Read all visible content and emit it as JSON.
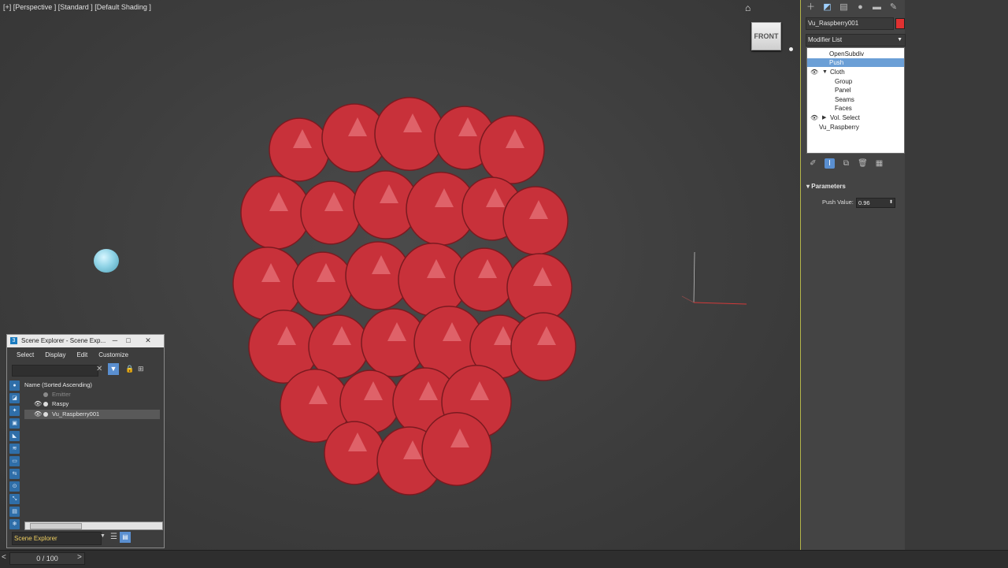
{
  "viewport": {
    "label": "[+] [Perspective ] [Standard ] [Default Shading ]",
    "viewcube_label": "FRONT",
    "object_color": "#c8313a"
  },
  "timeline": {
    "frame": "0 / 100",
    "prev": "<",
    "next": ">"
  },
  "command_panel": {
    "tab_icons": [
      "create-icon",
      "modify-icon",
      "hierarchy-icon",
      "motion-icon",
      "display-icon",
      "utilities-icon"
    ],
    "object_name": "Vu_Raspberry001",
    "object_color": "#e03131",
    "modifier_list_label": "Modifier List",
    "stack": {
      "opensubdiv": "OpenSubdiv",
      "push": "Push",
      "cloth": "Cloth",
      "group": "Group",
      "panel": "Panel",
      "seams": "Seams",
      "faces": "Faces",
      "vol_select": "Vol. Select",
      "base": "Vu_Raspberry"
    },
    "parameters_title": "Parameters",
    "push_value_label": "Push Value:",
    "push_value": "0.96"
  },
  "scene_explorer": {
    "title": "Scene Explorer - Scene Exp...",
    "app_icon": "3",
    "menu": {
      "select": "Select",
      "display": "Display",
      "edit": "Edit",
      "customize": "Customize"
    },
    "column_header": "Name (Sorted Ascending)",
    "rows": {
      "emitter": "Emitter",
      "raspy": "Raspy",
      "vu_raspberry001": "Vu_Raspberry001"
    },
    "footer_label": "Scene Explorer"
  }
}
